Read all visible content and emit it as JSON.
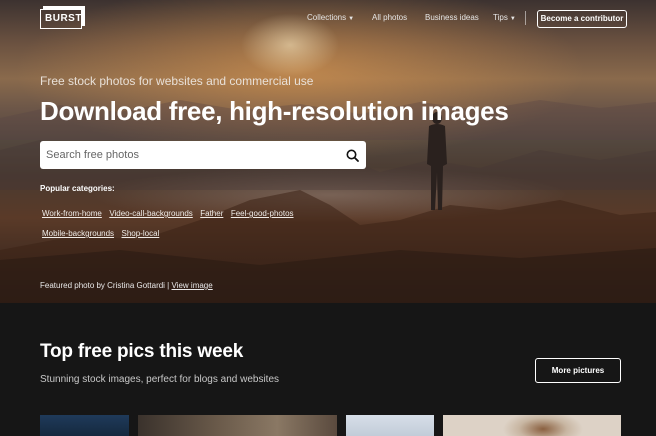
{
  "nav": {
    "logo": "BURST",
    "collections": "Collections",
    "all_photos": "All photos",
    "business_ideas": "Business ideas",
    "tips": "Tips",
    "contributor": "Become a contributor"
  },
  "hero": {
    "subtitle": "Free stock photos for websites and commercial use",
    "title": "Download free, high-resolution images",
    "search_placeholder": "Search free photos",
    "popular_label": "Popular categories:",
    "categories": [
      "Work-from-home",
      "Video-call-backgrounds",
      "Father",
      "Feel-good-photos",
      "Mobile-backgrounds",
      "Shop-local"
    ],
    "featured_prefix": "Featured photo by Cristina Gottardi |",
    "featured_link": "View image"
  },
  "section": {
    "title": "Top free pics this week",
    "subtitle": "Stunning stock images, perfect for blogs and websites",
    "more_button": "More pictures"
  },
  "icons": {
    "search": "search-icon",
    "caret": "chevron-down-icon"
  },
  "colors": {
    "page_bg": "#161616",
    "text": "#ffffff"
  }
}
